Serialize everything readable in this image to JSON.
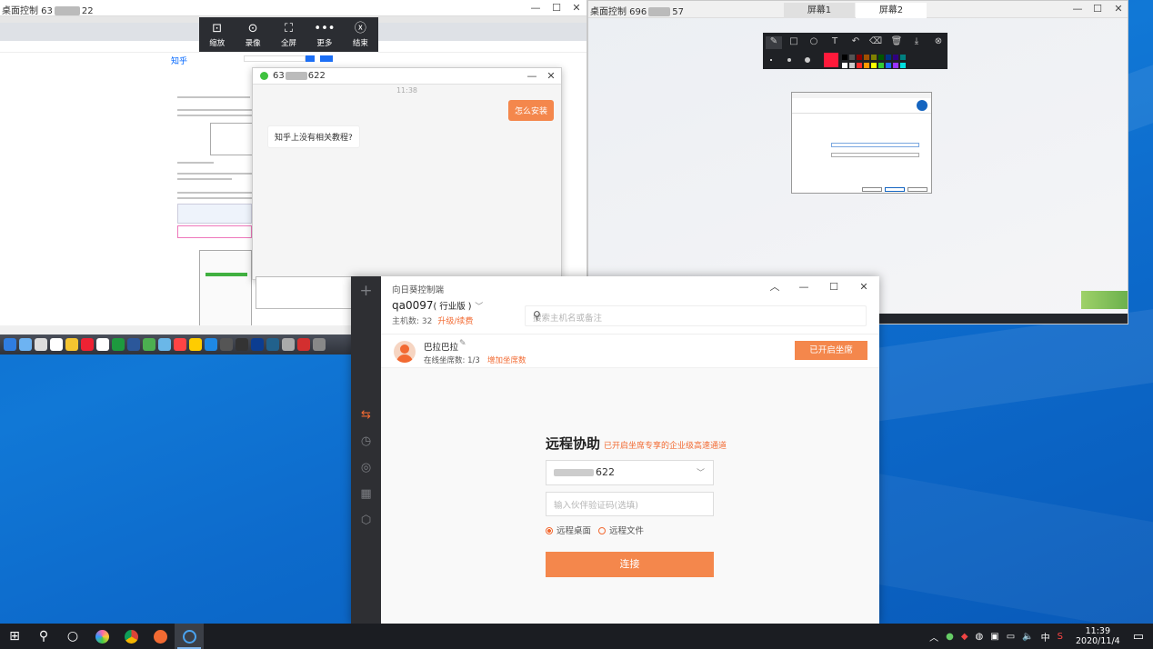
{
  "left_remote": {
    "title": "桌面控制 63",
    "title_suffix": "22"
  },
  "right_remote": {
    "title": "桌面控制 696",
    "title_suffix": "57",
    "tabs": [
      "屏幕1",
      "屏幕2"
    ]
  },
  "toolbar": {
    "items": [
      {
        "icon": "scale-icon",
        "label": "缩放"
      },
      {
        "icon": "record-icon",
        "label": "录像"
      },
      {
        "icon": "fullscreen-icon",
        "label": "全屏"
      },
      {
        "icon": "more-icon",
        "label": "更多"
      },
      {
        "icon": "close-circle-icon",
        "label": "结束"
      }
    ]
  },
  "chat": {
    "name": "63",
    "name_suffix": "622",
    "time": "11:38",
    "messages": [
      {
        "from": "me",
        "text": "怎么安装"
      },
      {
        "from": "them",
        "text": "知乎上没有相关教程?"
      }
    ]
  },
  "app": {
    "title": "向日葵控制端",
    "account": "qa0097",
    "edition": "( 行业版 )",
    "host_count_label": "主机数: 32",
    "upgrade_link": "升级/续费",
    "search_placeholder": "搜索主机名或备注",
    "user_name": "巴拉巴拉",
    "seats_label": "在线坐席数: 1/3",
    "add_seats_link": "增加坐席数",
    "seat_button": "已开启坐席",
    "assist_title": "远程协助",
    "assist_subtitle": "已开启坐席专享的企业级高速通道",
    "host_value_suffix": "622",
    "verify_placeholder": "输入伙伴验证码(选填)",
    "radio_desktop": "远程桌面",
    "radio_file": "远程文件",
    "connect_button": "连接"
  },
  "taskbar": {
    "time": "11:39",
    "date": "2020/11/4",
    "ime": "中"
  },
  "zhihu": {
    "logo": "知乎"
  },
  "colors": {
    "accent": "#f26a32",
    "button": "#f4874c",
    "sidebar": "#2e2f33",
    "desktop": "#0d6bcc"
  }
}
